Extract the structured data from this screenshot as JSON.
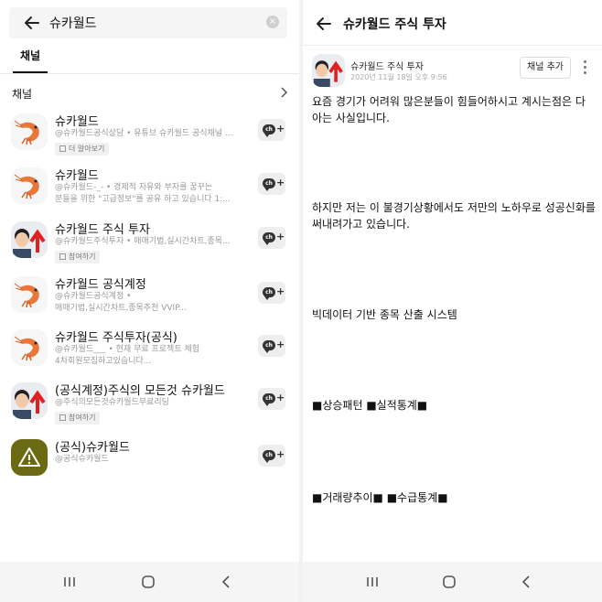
{
  "left": {
    "search": {
      "query": "슈카월드",
      "clear_icon": "×"
    },
    "tab_label": "채널",
    "section_label": "채널",
    "channels": [
      {
        "name": "슈카월드",
        "desc1": "@슈카월드공식상담 • 유튜브 슈카월드 공식채널 ...",
        "desc2": "",
        "badge": "더 알아보기",
        "avatar": "shrimp"
      },
      {
        "name": "슈카월드",
        "desc1": "@슈카월드-_- • 경제적 자유와 부자를 꿈꾸는",
        "desc2": "분들을 위한 \"고급정보\"를 공유 하고 있습니다 1:...",
        "badge": "",
        "avatar": "shrimp"
      },
      {
        "name": "슈카월드 주식 투자",
        "desc1": "@슈카월드주식투자 • 매매기법,실시간차트,종목...",
        "desc2": "",
        "badge": "참여하기",
        "avatar": "person-arrow"
      },
      {
        "name": "슈카월드 공식계정",
        "desc1": "@슈카월드공식계정 •",
        "desc2": "매매기법,실시간차트,종목추천 VVIP...",
        "badge": "",
        "avatar": "shrimp"
      },
      {
        "name": "슈카월드 주식투자(공식)",
        "desc1": "@슈카월드___ • 현재 무료 프로젝트 체험",
        "desc2": "4차회원모집하고있습니다...",
        "badge": "",
        "avatar": "shrimp"
      },
      {
        "name": "(공식계정)주식의 모든것 슈카월드",
        "desc1": "@주식의모든것슈카월드무료리딩",
        "desc2": "",
        "badge": "참여하기",
        "avatar": "person-arrow"
      },
      {
        "name": "(공식)슈카월드",
        "desc1": "@공식슈카월드",
        "desc2": "",
        "badge": "",
        "avatar": "warning"
      }
    ],
    "add_channel_icon_text": "ch"
  },
  "right": {
    "title": "슈카월드 주식 투자",
    "channel_name": "슈카월드 주식 투자",
    "date": "2020년 11월 18일 오후 9:56",
    "add_button": "채널 추가",
    "paragraphs": [
      "요즘 경기가 어려워 많은분들이 힘들어하시고 계시는점은 다 아는 사실입니다.",
      "하지만 저는 이 불경기상황에서도 저만의 노하우로 성공신화를 써내려가고 있습니다.",
      "빅데이터 기반 종목 산출 시스템",
      "■상승패턴 ■실적통계■",
      "■거래량추이■ ■수급통계■"
    ]
  },
  "colors": {
    "shrimp_body": "#e8773a",
    "warning_bg": "#6b6a12",
    "arrow_red": "#e02020"
  }
}
